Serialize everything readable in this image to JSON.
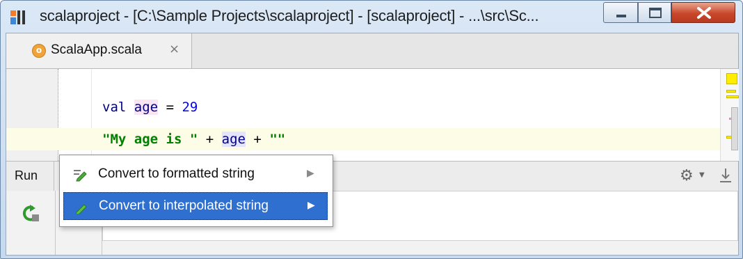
{
  "window": {
    "title": "scalaproject - [C:\\Sample Projects\\scalaproject] - [scalaproject] - ...\\src\\Sc...",
    "app_icon": "intellij-logo-icon"
  },
  "editor_tab": {
    "label": "ScalaApp.scala",
    "icon_letter": "o",
    "close_glyph": "×"
  },
  "code": {
    "line1": {
      "keyword": "val",
      "ident": "age",
      "op": "=",
      "number": "29"
    },
    "line2": {
      "string1": "\"My age is \"",
      "plus1": "+",
      "ident": "age",
      "plus2": "+",
      "string2": "\"\""
    }
  },
  "run_panel": {
    "label": "Run",
    "icons": [
      "rerun-icon",
      "scroll-up-icon",
      "gear-icon",
      "pin-icon"
    ]
  },
  "intention_popup": {
    "items": [
      {
        "label": "Convert to formatted string",
        "icon": "pencil-icon",
        "selected": false
      },
      {
        "label": "Convert to interpolated string",
        "icon": "pencil-icon",
        "selected": true
      }
    ],
    "arrow_glyph": "▶"
  },
  "colors": {
    "selection": "#2f6fd0",
    "string": "#008000",
    "keyword": "#000080",
    "number": "#0000ff",
    "marker": "#ffee00"
  }
}
